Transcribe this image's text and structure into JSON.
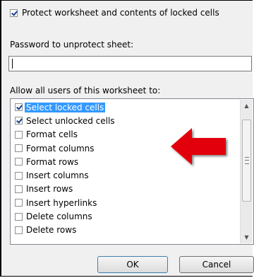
{
  "protect": {
    "checked": true,
    "label": "Protect worksheet and contents of locked cells"
  },
  "password": {
    "label": "Password to unprotect sheet:",
    "value": ""
  },
  "permissions": {
    "label": "Allow all users of this worksheet to:",
    "items": [
      {
        "label": "Select locked cells",
        "checked": true,
        "selected": true
      },
      {
        "label": "Select unlocked cells",
        "checked": true,
        "selected": false
      },
      {
        "label": "Format cells",
        "checked": false,
        "selected": false
      },
      {
        "label": "Format columns",
        "checked": false,
        "selected": false
      },
      {
        "label": "Format rows",
        "checked": false,
        "selected": false
      },
      {
        "label": "Insert columns",
        "checked": false,
        "selected": false
      },
      {
        "label": "Insert rows",
        "checked": false,
        "selected": false
      },
      {
        "label": "Insert hyperlinks",
        "checked": false,
        "selected": false
      },
      {
        "label": "Delete columns",
        "checked": false,
        "selected": false
      },
      {
        "label": "Delete rows",
        "checked": false,
        "selected": false
      }
    ]
  },
  "buttons": {
    "ok": "OK",
    "cancel": "Cancel"
  },
  "colors": {
    "arrow": "#e3000f",
    "selection": "#3399ff"
  },
  "icons": {
    "annotation": "red-arrow-icon",
    "scroll_up": "scroll-up-arrow-icon",
    "scroll_down": "scroll-down-arrow-icon"
  }
}
